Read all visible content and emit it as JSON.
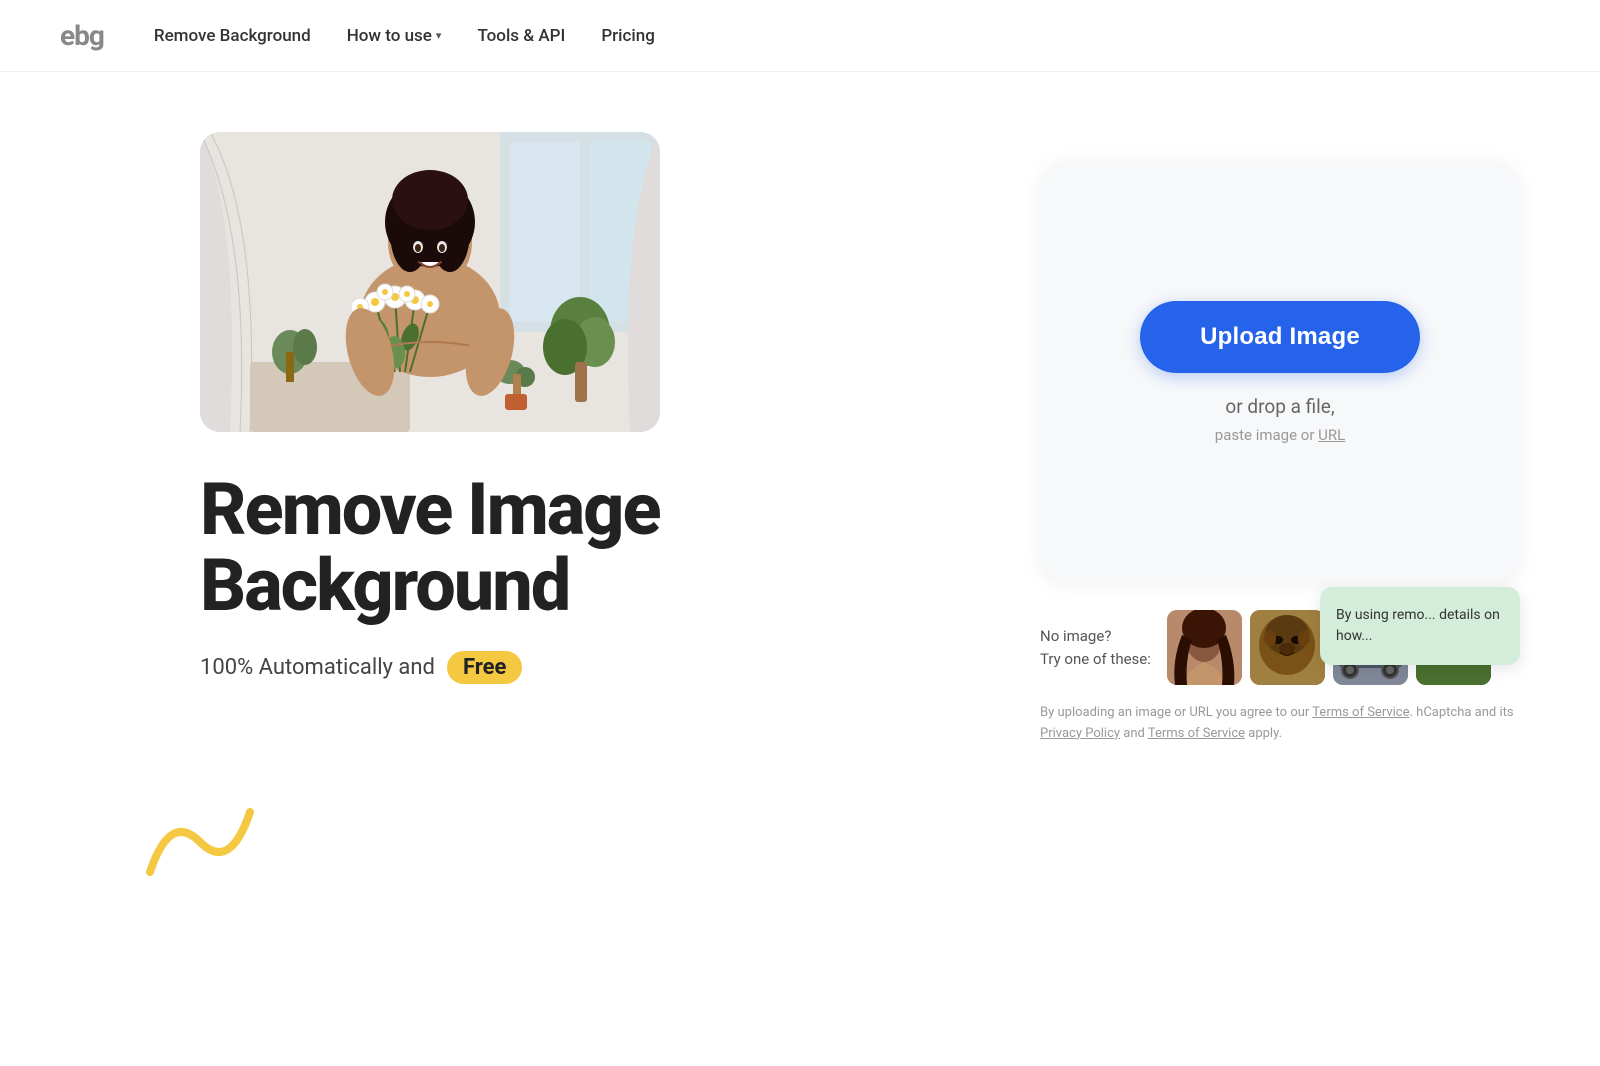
{
  "logo": {
    "text": "ebg"
  },
  "nav": {
    "links": [
      {
        "label": "Remove Background",
        "dropdown": false
      },
      {
        "label": "How to use",
        "dropdown": true
      },
      {
        "label": "Tools & API",
        "dropdown": false
      },
      {
        "label": "Pricing",
        "dropdown": false
      }
    ]
  },
  "hero": {
    "title": "Remove Image Background",
    "subtitle_prefix": "100% Automatically and",
    "free_badge": "Free"
  },
  "upload_card": {
    "upload_button_label": "Upload Image",
    "drop_text": "or drop a file,",
    "paste_text": "paste image or URL",
    "url_link_label": "URL"
  },
  "sample_images": {
    "no_image_label": "No image?",
    "try_label": "Try one of these:",
    "thumbs": [
      {
        "id": "thumb-1",
        "alt": "woman portrait"
      },
      {
        "id": "thumb-2",
        "alt": "bear"
      },
      {
        "id": "thumb-3",
        "alt": "car"
      },
      {
        "id": "thumb-4",
        "alt": "outdoor scene"
      }
    ]
  },
  "terms": {
    "text1": "By uploading an image or URL you agree to our",
    "terms_of_service_label": "Terms of Service",
    "text2": ". T... hCaptcha and its",
    "privacy_policy_label": "Privacy Policy",
    "text3": "and",
    "terms_label2": "Terms of Service",
    "text4": "apply."
  },
  "tooltip": {
    "text": "By using remo... details on how..."
  },
  "icons": {
    "chevron_down": "▾"
  }
}
